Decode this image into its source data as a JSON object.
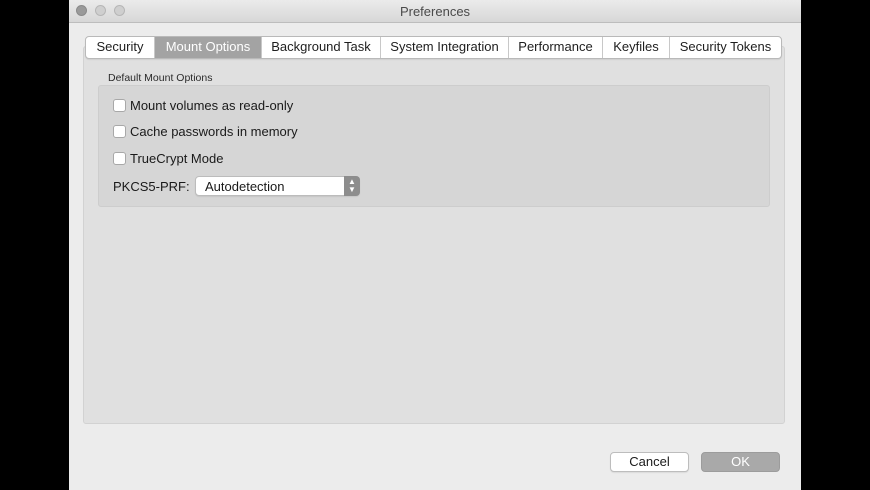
{
  "window": {
    "title": "Preferences"
  },
  "tabs": [
    {
      "label": "Security"
    },
    {
      "label": "Mount Options",
      "active": true
    },
    {
      "label": "Background Task"
    },
    {
      "label": "System Integration"
    },
    {
      "label": "Performance"
    },
    {
      "label": "Keyfiles"
    },
    {
      "label": "Security Tokens"
    }
  ],
  "mount_options": {
    "group_label": "Default Mount Options",
    "checkboxes": [
      {
        "label": "Mount volumes as read-only",
        "checked": false
      },
      {
        "label": "Cache passwords in memory",
        "checked": false
      },
      {
        "label": "TrueCrypt Mode",
        "checked": false
      }
    ],
    "prf_label": "PKCS5-PRF:",
    "prf_value": "Autodetection"
  },
  "buttons": {
    "cancel": "Cancel",
    "ok": "OK"
  },
  "colors": {
    "active_tab": "#a3a3a3",
    "ok_button": "#a9a9a9"
  }
}
